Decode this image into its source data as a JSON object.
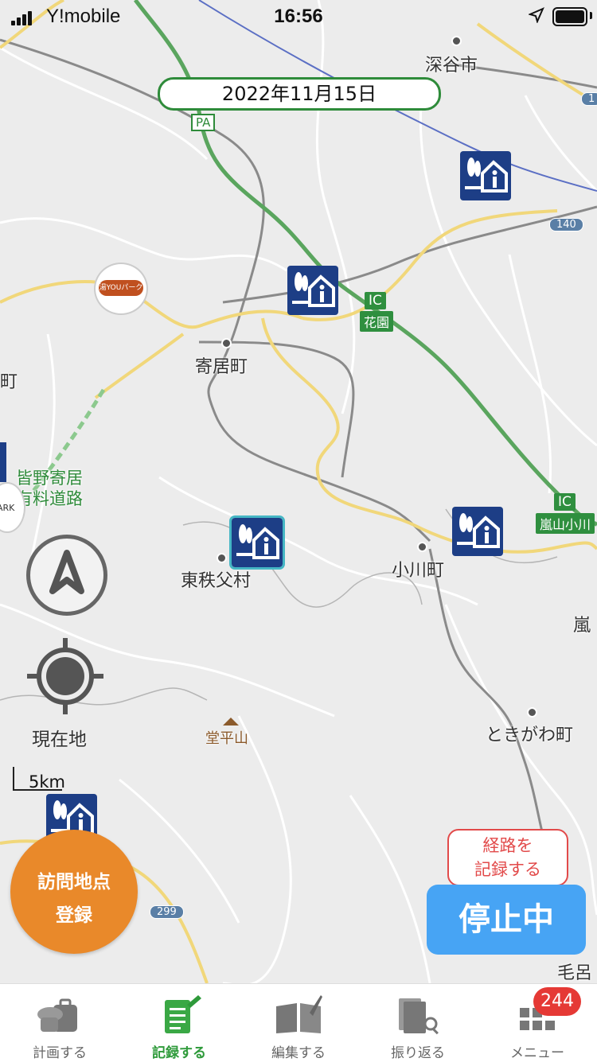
{
  "status_bar": {
    "carrier": "Y!mobile",
    "time": "16:56"
  },
  "date_label": "2022年11月15日",
  "map": {
    "places": {
      "fukaya": "深谷市",
      "yorii": "寄居町",
      "higashichichibu": "東秩父村",
      "ogawa": "小川町",
      "tokigawa": "ときがわ町",
      "ranzan": "嵐",
      "moro": "毛呂",
      "toudaira": "堂平山",
      "toll_road": "皆野寄居\n有料道路",
      "left_edge": "町"
    },
    "shields": {
      "pa": "PA",
      "ic1": "IC",
      "ic1_name": "花園",
      "ic2": "IC",
      "ic2_name": "嵐山小川",
      "route140": "140",
      "route299": "299",
      "route_right": "1"
    },
    "onsen_logo_text": "湯YOUパーク",
    "park_text": "ARK"
  },
  "controls": {
    "locate_label": "現在地",
    "scale_label": "5km"
  },
  "buttons": {
    "visit_line1": "訪問地点",
    "visit_line2": "登録",
    "record_tip_line1": "経路を",
    "record_tip_line2": "記録する",
    "stop_label": "停止中"
  },
  "tabs": [
    {
      "label": "計画する",
      "icon": "luggage-icon"
    },
    {
      "label": "記録する",
      "icon": "notepad-pen-icon",
      "active": true
    },
    {
      "label": "編集する",
      "icon": "book-pen-icon"
    },
    {
      "label": "振り返る",
      "icon": "album-search-icon"
    },
    {
      "label": "メニュー",
      "icon": "grid-menu-icon"
    }
  ],
  "menu_badge": "244",
  "colors": {
    "accent_green": "#2e9a3a",
    "visit_orange": "#e9892a",
    "stop_blue": "#47a4f4",
    "alert_red": "#e53935",
    "poi_navy": "#1d3e86"
  }
}
